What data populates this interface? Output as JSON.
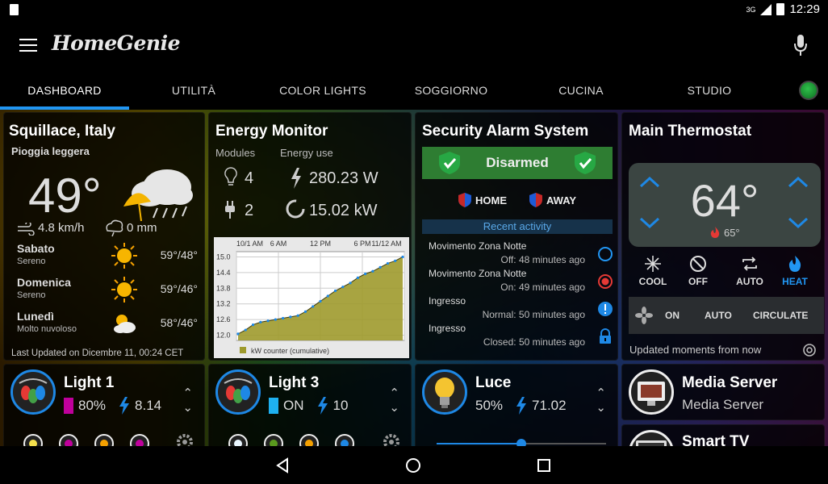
{
  "status": {
    "signal": "3G",
    "time": "12:29"
  },
  "app": {
    "title": "HomeGenie"
  },
  "tabs": [
    {
      "label": "DASHBOARD"
    },
    {
      "label": "UTILITÀ"
    },
    {
      "label": "COLOR LIGHTS"
    },
    {
      "label": "SOGGIORNO"
    },
    {
      "label": "CUCINA"
    },
    {
      "label": "STUDIO"
    }
  ],
  "weather": {
    "title": "Squillace, Italy",
    "condition": "Pioggia leggera",
    "temperature": "49°",
    "wind": "4.8 km/h",
    "rain": "0 mm",
    "forecast": [
      {
        "day": "Sabato",
        "desc": "Sereno",
        "temp": "59°/48°",
        "icon": "sun-icon"
      },
      {
        "day": "Domenica",
        "desc": "Sereno",
        "temp": "59°/46°",
        "icon": "sun-icon"
      },
      {
        "day": "Lunedì",
        "desc": "Molto nuvoloso",
        "temp": "58°/46°",
        "icon": "cloudy-icon"
      }
    ],
    "updated": "Last Updated on Dicembre 11, 00:24 CET"
  },
  "energy": {
    "title": "Energy Monitor",
    "modules_label": "Modules",
    "usage_label": "Energy use",
    "lights_count": "4",
    "plugs_count": "2",
    "power": "280.23 W",
    "counter": "15.02 kW"
  },
  "chart_data": {
    "type": "line",
    "x_ticks": [
      "10/1 AM",
      "6 AM",
      "12 PM",
      "6 PM",
      "11/12 AM"
    ],
    "y_ticks": [
      "15.0",
      "14.4",
      "13.8",
      "13.2",
      "12.6",
      "12.0"
    ],
    "ylim": [
      11.8,
      15.2
    ],
    "series": [
      {
        "name": "kW counter (cumulative)",
        "values": [
          12.05,
          12.2,
          12.4,
          12.5,
          12.55,
          12.6,
          12.65,
          12.7,
          12.75,
          12.9,
          13.1,
          13.3,
          13.5,
          13.7,
          13.85,
          14.0,
          14.2,
          14.35,
          14.45,
          14.6,
          14.75,
          14.85,
          15.0
        ]
      }
    ]
  },
  "security": {
    "title": "Security Alarm System",
    "status": "Disarmed",
    "home_label": "HOME",
    "away_label": "AWAY",
    "recent_label": "Recent activity",
    "activity": [
      {
        "name": "Movimento Zona Notte",
        "state": "Off: 48 minutes ago",
        "icon": "circle-outline-icon"
      },
      {
        "name": "Movimento Zona Notte",
        "state": "On: 49 minutes ago",
        "icon": "record-icon"
      },
      {
        "name": "Ingresso",
        "state": "Normal: 50 minutes ago",
        "icon": "alert-icon"
      },
      {
        "name": "Ingresso",
        "state": "Closed: 50 minutes ago",
        "icon": "lock-icon"
      }
    ]
  },
  "thermostat": {
    "title": "Main Thermostat",
    "temperature": "64°",
    "setpoint": "65°",
    "modes": [
      {
        "label": "COOL",
        "icon": "snowflake-icon"
      },
      {
        "label": "OFF",
        "icon": "block-icon"
      },
      {
        "label": "AUTO",
        "icon": "repeat-icon"
      },
      {
        "label": "HEAT",
        "icon": "flame-icon"
      }
    ],
    "fan": [
      {
        "label": "ON"
      },
      {
        "label": "AUTO"
      },
      {
        "label": "CIRCULATE"
      }
    ],
    "updated": "Updated moments from now"
  },
  "light1": {
    "name": "Light 1",
    "level": "80%",
    "power": "8.14",
    "color": "#c0009c"
  },
  "light3": {
    "name": "Light 3",
    "level": "ON",
    "power": "10",
    "color": "#1eb0f0"
  },
  "luce": {
    "name": "Luce",
    "level": "50%",
    "power": "71.02",
    "dimmer_value": 0.5
  },
  "media": [
    {
      "title": "Media Server",
      "subtitle": "Media Server"
    },
    {
      "title": "Smart TV"
    }
  ],
  "colors": {
    "accent": "#2196f3",
    "armed_red": "#c62828",
    "disarmed_green": "#2e7d32",
    "heat": "#2196f3"
  }
}
